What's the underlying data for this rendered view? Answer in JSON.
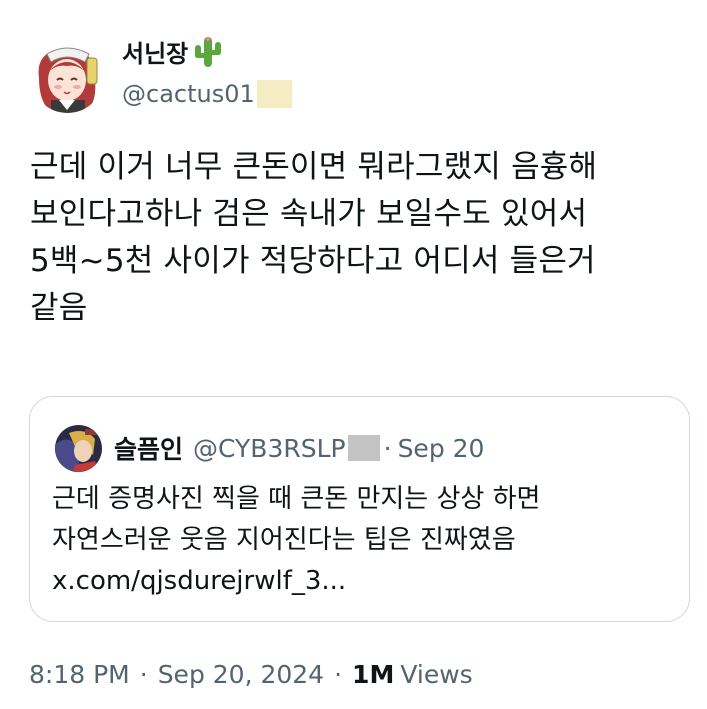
{
  "author": {
    "display_name": "서닌장",
    "handle": "@cactus01",
    "avatar_icon": "anime-avatar",
    "name_emoji_icon": "cactus-icon"
  },
  "tweet": {
    "lines": [
      "근데 이거 너무 큰돈이면 뭐라그랬지 음흉해",
      "보인다고하나 검은 속내가 보일수도 있어서",
      "5백~5천 사이가 적당하다고 어디서 들은거",
      "같음"
    ]
  },
  "quote": {
    "display_name": "슬픔인",
    "handle": "@CYB3RSLP",
    "separator": "·",
    "date": "Sep 20",
    "avatar_icon": "character-avatar",
    "lines": [
      "근데 증명사진 찍을 때 큰돈 만지는 상상 하면",
      "자연스러운 웃음 지어진다는 팁은 진짜였음",
      "x.com/qjsdurejrwlf_3..."
    ]
  },
  "meta": {
    "time": "8:18 PM",
    "dot1": "·",
    "date": "Sep 20, 2024",
    "dot2": "·",
    "views_count": "1M",
    "views_label": "Views"
  },
  "colors": {
    "text": "#0f1419",
    "secondary": "#536471",
    "border": "#cfd9de"
  }
}
